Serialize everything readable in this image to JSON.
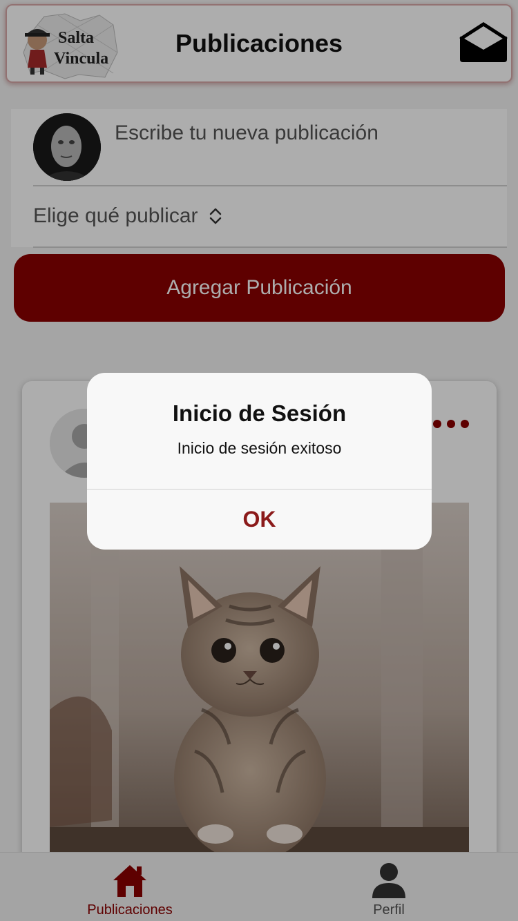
{
  "header": {
    "logo_text": [
      "Salta",
      "Vincula"
    ],
    "title": "Publicaciones",
    "mail_icon": "envelope-icon"
  },
  "composer": {
    "placeholder": "Escribe tu nueva publicación",
    "type_select_label": "Elige qué publicar",
    "type_select_icon": "chevron-up-down-icon",
    "submit_label": "Agregar Publicación"
  },
  "post": {
    "author_avatar": "default-user-avatar",
    "more_icon": "more-dots-icon",
    "image_subject": "kitten photo"
  },
  "bottom_nav": {
    "items": [
      {
        "label": "Publicaciones",
        "icon": "home-icon",
        "active": true
      },
      {
        "label": "Perfil",
        "icon": "user-icon",
        "active": false
      }
    ]
  },
  "dialog": {
    "title": "Inicio de Sesión",
    "message": "Inicio de sesión exitoso",
    "ok_label": "OK"
  },
  "colors": {
    "accent": "#8b0000",
    "dialog_ok": "#8b1a1a",
    "overlay": "rgba(0,0,0,0.32)"
  }
}
